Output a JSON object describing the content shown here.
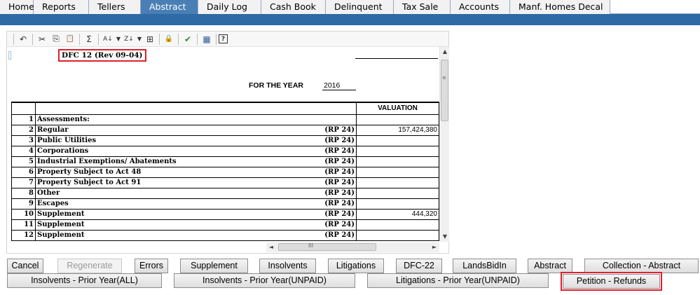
{
  "tabs": [
    "Home",
    "Reports",
    "Tellers",
    "Abstract",
    "Daily Log",
    "Cash Book",
    "Delinquent",
    "Tax Sale",
    "Accounts",
    "Manf. Homes Decal"
  ],
  "active_tab": "Abstract",
  "toolbar": {
    "icons": [
      "undo-icon",
      "cut-icon",
      "copy-icon",
      "paste-icon",
      "sum-icon",
      "sort-ascending-icon",
      "sort-descending-icon",
      "filter-icon",
      "protect-icon",
      "export-excel-icon",
      "calculator-icon",
      "help-icon"
    ],
    "glyphs": {
      "undo": "↶",
      "cut": "✂",
      "copy": "⎘",
      "paste": "📋",
      "sum": "Σ",
      "sort_asc": "A↓",
      "sort_desc": "Z↓",
      "filter": "⊞",
      "protect": "🔒",
      "export": "✔",
      "calc": "▦",
      "help": "?",
      "dropdown": "▼"
    }
  },
  "document": {
    "form_id": "DFC 12 (Rev 09-04)",
    "for_year_label": "FOR THE YEAR",
    "for_year_value": "2016",
    "valuation_header": "VALUATION",
    "rows": [
      {
        "num": "1",
        "desc": "Assessments:",
        "ref": "",
        "value": ""
      },
      {
        "num": "2",
        "desc": "Regular",
        "ref": "(RP 24)",
        "value": "157,424,380"
      },
      {
        "num": "3",
        "desc": "Public Utilities",
        "ref": "(RP 24)",
        "value": ""
      },
      {
        "num": "4",
        "desc": "Corporations",
        "ref": "(RP 24)",
        "value": ""
      },
      {
        "num": "5",
        "desc": "Industrial Exemptions/ Abatements",
        "ref": "(RP 24)",
        "value": ""
      },
      {
        "num": "6",
        "desc": "Property Subject to Act 48",
        "ref": "(RP 24)",
        "value": ""
      },
      {
        "num": "7",
        "desc": "Property Subject to Act 91",
        "ref": "(RP 24)",
        "value": ""
      },
      {
        "num": "8",
        "desc": "Other",
        "ref": "(RP 24)",
        "value": ""
      },
      {
        "num": "9",
        "desc": "Escapes",
        "ref": "(RP 24)",
        "value": ""
      },
      {
        "num": "10",
        "desc": "Supplement",
        "ref": "(RP 24)",
        "value": "444,320"
      },
      {
        "num": "11",
        "desc": "Supplement",
        "ref": "(RP 24)",
        "value": ""
      },
      {
        "num": "12",
        "desc": "Supplement",
        "ref": "(RP 24)",
        "value": ""
      }
    ]
  },
  "scrollbar_glyphs": {
    "up": "▲",
    "down": "▼",
    "left": "◄",
    "right": "►",
    "vgrip": "≡",
    "hgrip": "III"
  },
  "buttons_row1": [
    "Cancel",
    "Regenerate",
    "Errors",
    "Supplement",
    "Insolvents",
    "Litigations",
    "DFC-22",
    "LandsBidIn",
    "Abstract",
    "Collection - Abstract"
  ],
  "buttons_row2": [
    "Insolvents - Prior Year(ALL)",
    "Insolvents - Prior Year(UNPAID)",
    "Litigations - Prior Year(UNPAID)",
    "Petition - Refunds"
  ],
  "disabled_button": "Regenerate",
  "highlighted_button": "Petition - Refunds",
  "colors": {
    "accent_band": "#2e6aa6",
    "active_tab": "#4a7fb5",
    "highlight": "#e0202a"
  }
}
